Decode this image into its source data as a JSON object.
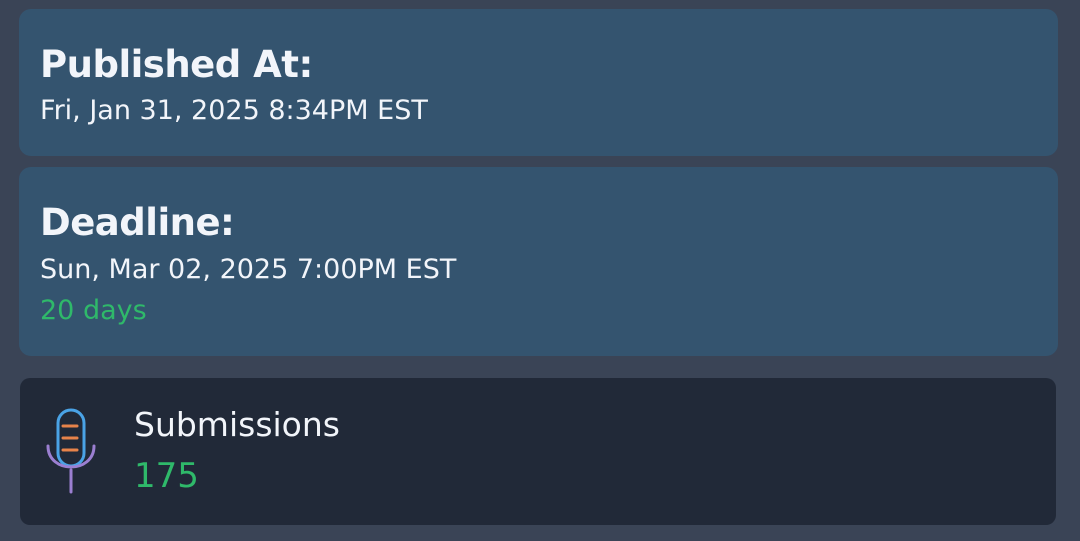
{
  "published": {
    "title": "Published At:",
    "value": "Fri, Jan 31, 2025 8:34PM EST"
  },
  "deadline": {
    "title": "Deadline:",
    "value": "Sun, Mar 02, 2025 7:00PM EST",
    "remaining": "20 days"
  },
  "submissions": {
    "icon": "microphone-icon",
    "label": "Submissions",
    "count": "175"
  },
  "colors": {
    "background": "#3a4456",
    "info_card": "#34546f",
    "dark_card": "#212938",
    "accent_green": "#2fb96a",
    "text": "#f2f5fa",
    "mic_blue": "#4aa3e6",
    "mic_orange": "#e8834a",
    "mic_purple": "#9b7fd1"
  }
}
